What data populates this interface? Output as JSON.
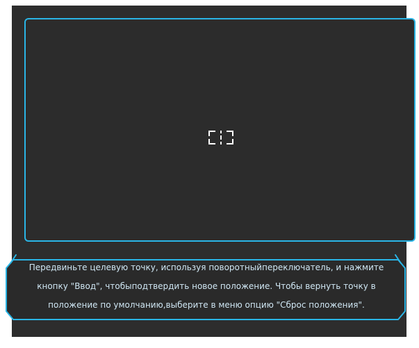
{
  "screen": {
    "message": "Передвиньте целевую точку, используя поворотныйпереключатель, и нажмите кнопку \"Ввод\", чтобыподтвердить новое положение. Чтобы вернуть точку в положение по умолчанию,выберите в меню опцию \"Сброс положения\"."
  },
  "icons": {
    "target": "target-marker-icon"
  },
  "colors": {
    "accent": "#2ab5e6",
    "background": "#2d2d2d",
    "text": "#cfe6f3"
  }
}
